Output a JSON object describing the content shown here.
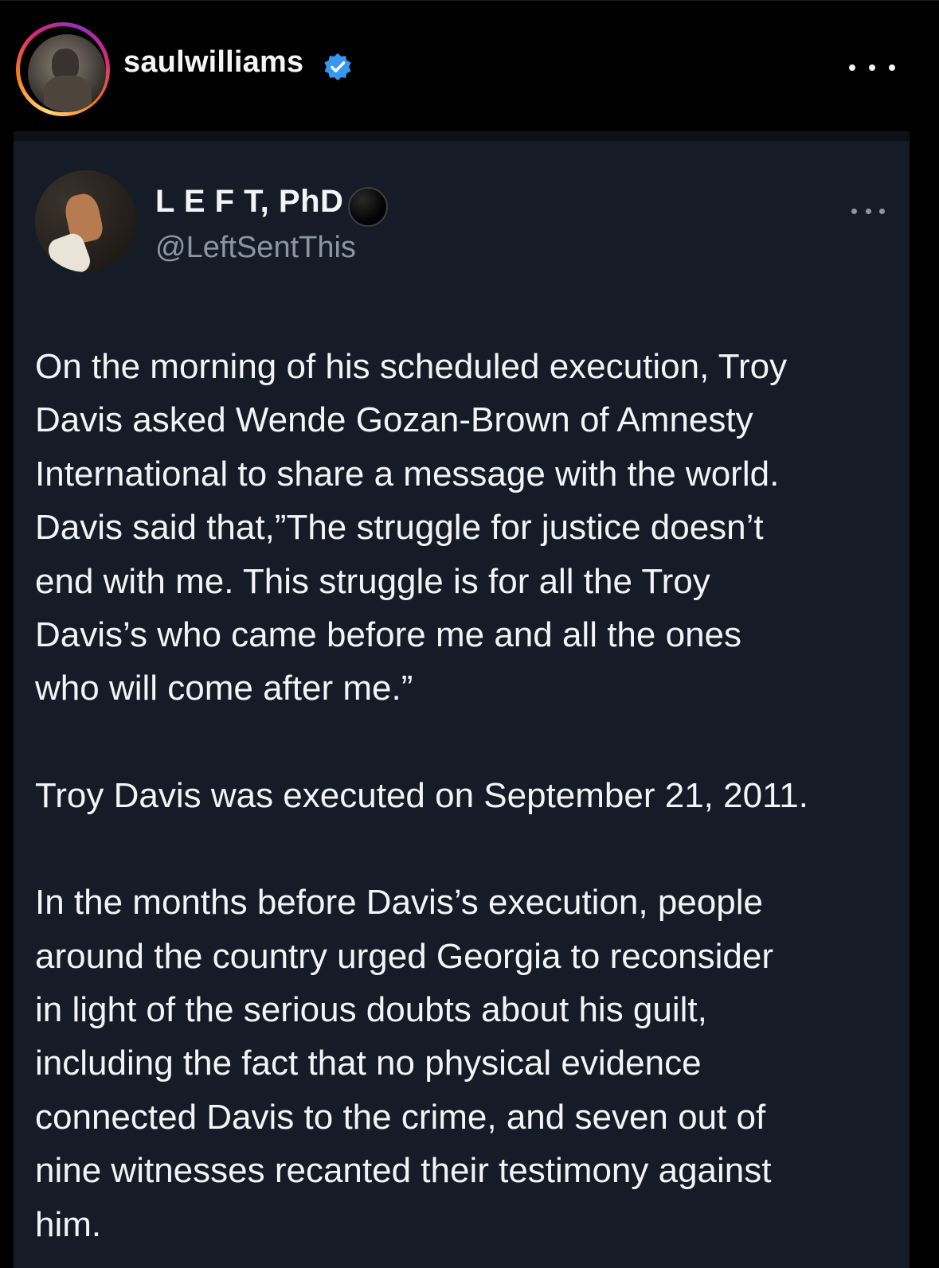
{
  "instagram": {
    "username": "saulwilliams",
    "verified_icon": "verified-badge-icon",
    "more_icon": "more-dots-icon",
    "verified_color": "#3897f0"
  },
  "tweet": {
    "display_name": "L E F T, PhD",
    "handle": "@LeftSentThis",
    "badge_icon": "black-circle-icon",
    "more_icon": "more-dots-icon",
    "paragraphs": [
      "On the morning of his scheduled execution, Troy\nDavis asked Wende Gozan-Brown of Amnesty\nInternational to share a message with the world.\nDavis said that,”The struggle for justice doesn’t\nend with me. This struggle is for all the Troy\nDavis’s who came before me and all the ones\nwho will come after me.”",
      "Troy Davis was executed on September 21, 2011.",
      "In the months before Davis’s execution, people\naround the country urged Georgia to reconsider\nin light of the serious doubts about his guilt,\nincluding the fact that no physical evidence\nconnected Davis to the crime, and seven out of\nnine witnesses recanted their testimony against\nhim."
    ]
  },
  "colors": {
    "background": "#000000",
    "card": "#151c27",
    "text": "#f2f4f7",
    "muted": "#8b96a5"
  }
}
